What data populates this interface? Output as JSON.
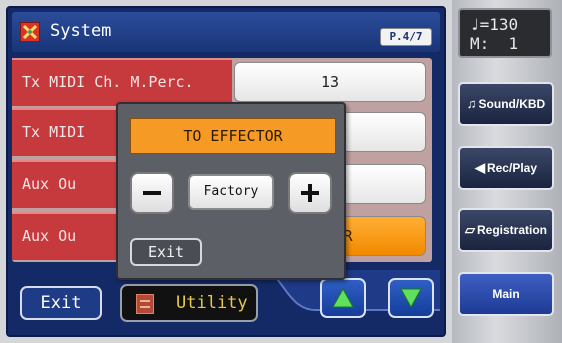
{
  "title": "System",
  "page": "P.4/7",
  "rows": [
    {
      "label": "Tx MIDI Ch. M.Perc.",
      "value": "13"
    },
    {
      "label": "Tx MIDI",
      "value": ""
    },
    {
      "label": "Aux Ou",
      "value": ""
    },
    {
      "label": "Aux Ou",
      "value": "ECTOR"
    }
  ],
  "popup": {
    "value": "TO EFFECTOR",
    "factory_label": "Factory",
    "exit_label": "Exit",
    "minus_icon": "minus-icon",
    "plus_icon": "plus-icon"
  },
  "bottom": {
    "exit_label": "Exit",
    "utility_label": "Utility"
  },
  "tempo": {
    "line1": "♩=130",
    "line2": "M:  1"
  },
  "side": {
    "sound_label": "Sound/KBD",
    "rec_label": "Rec/Play",
    "reg_label": "Registration",
    "main_label": "Main"
  },
  "colors": {
    "panel": "#142a66",
    "row_label": "#c6393c",
    "active_value": "#f28a00",
    "popup_bg": "#5c5f66"
  }
}
